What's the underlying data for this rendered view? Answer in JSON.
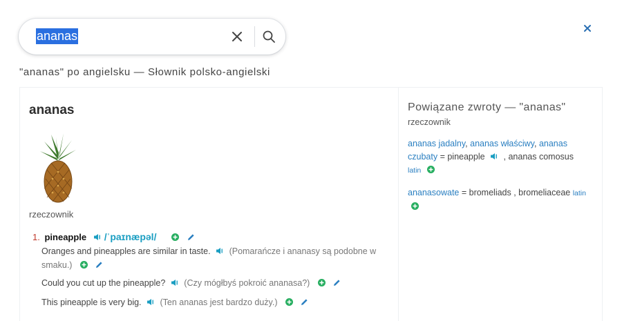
{
  "search": {
    "value": "ananas"
  },
  "heading": "\"ananas\" po angielsku — Słownik polsko-angielski",
  "entry": {
    "headword": "ananas",
    "pos": "rzeczownik",
    "senses": [
      {
        "number": "1.",
        "translation": "pineapple",
        "ipa": "/ˈpaɪnæpəl/",
        "examples": [
          {
            "text": "Oranges and pineapples are similar in taste.",
            "translation": "(Pomarańcze i ananasy są podobne w smaku.)"
          },
          {
            "text": "Could you cut up the pineapple?",
            "translation": "(Czy mógłbyś pokroić ananasa?)"
          },
          {
            "text": "This pineapple is very big.",
            "translation": "(Ten ananas jest bardzo duży.)"
          }
        ]
      }
    ]
  },
  "related": {
    "title": "Powiązane zwroty — \"ananas\"",
    "pos": "rzeczownik",
    "item1": {
      "link1": "ananas jadalny",
      "sep1": ", ",
      "link2": "ananas właściwy",
      "sep2": ", ",
      "link3": "ananas czubaty",
      "eq": " = pineapple",
      "rest": " , ananas comosus",
      "latin": "latin"
    },
    "item2": {
      "link1": "ananasowate",
      "eq": " = bromeliads , bromeliaceae",
      "latin": "latin"
    }
  },
  "colors": {
    "accent": "#2a7fc1",
    "ipa": "#1a9ec2",
    "add": "#27ae60",
    "edit": "#2a7fc1",
    "selection": "#2a6fe0"
  }
}
